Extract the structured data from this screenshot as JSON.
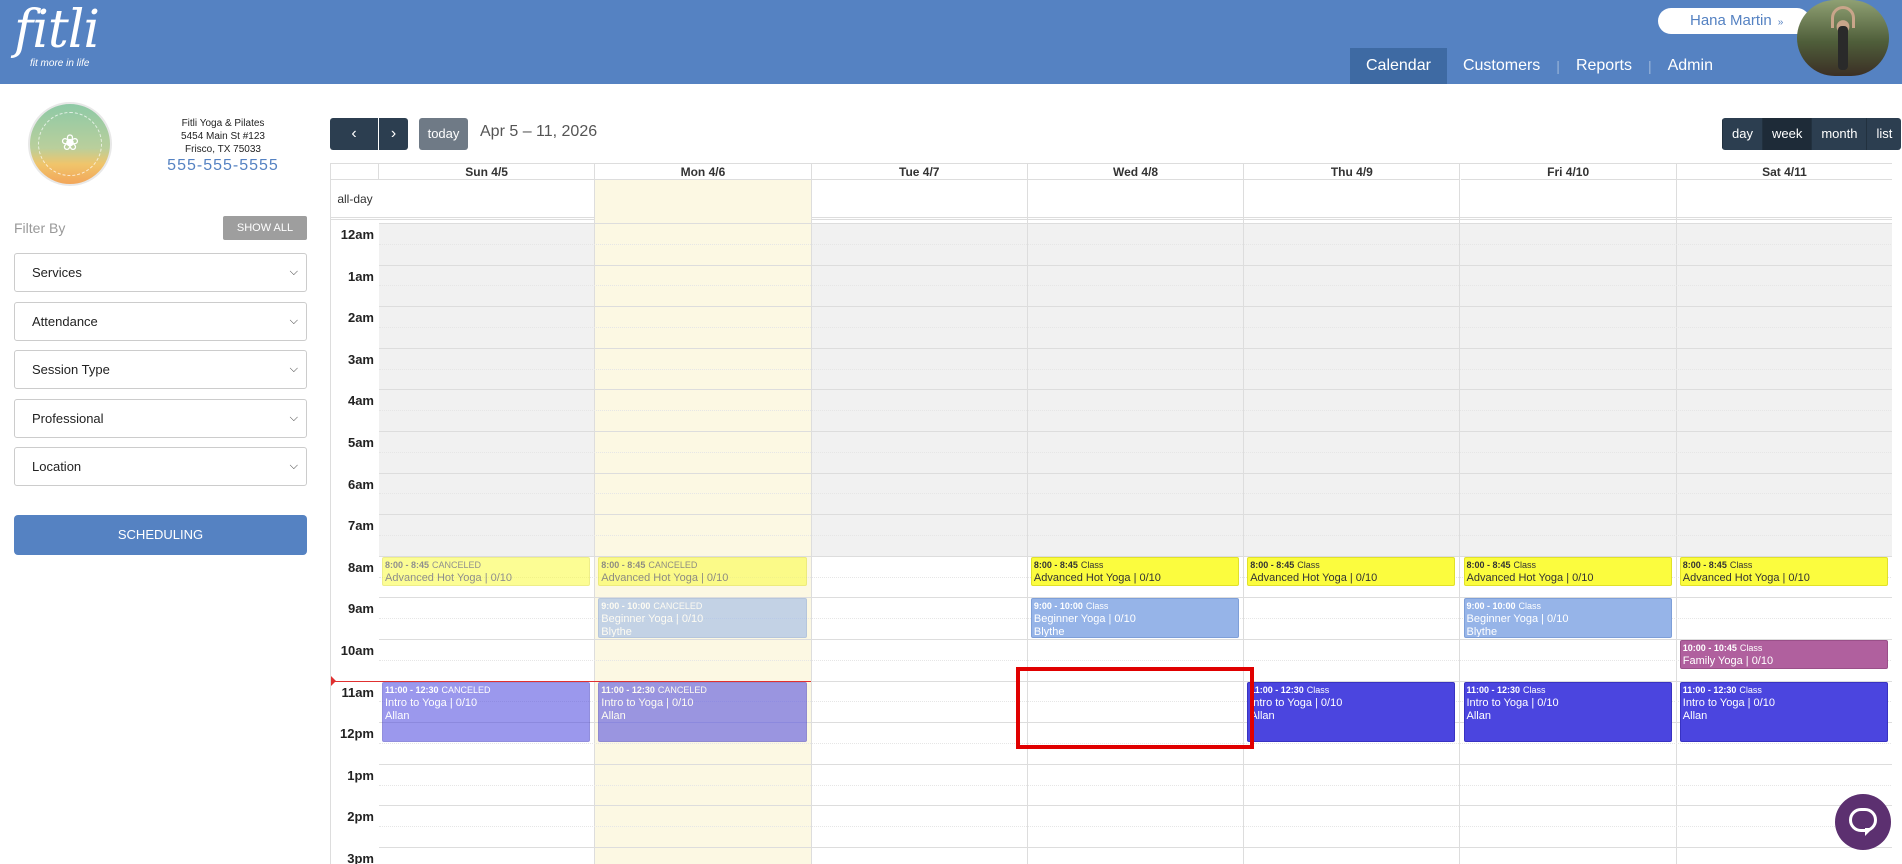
{
  "brand": {
    "logo_text": "fitli",
    "tagline": "fit more in life",
    "color": "#5582c2"
  },
  "user": {
    "name": "Hana Martin",
    "chevron": "»"
  },
  "nav": {
    "items": [
      "Calendar",
      "Customers",
      "Reports",
      "Admin"
    ],
    "active": "Calendar"
  },
  "studio": {
    "name": "Fitli Yoga & Pilates",
    "address1": "5454 Main St #123",
    "address2": "Frisco, TX 75033",
    "phone": "555-555-5555"
  },
  "filters": {
    "label": "Filter By",
    "show_all": "SHOW ALL",
    "selects": [
      "Services",
      "Attendance",
      "Session Type",
      "Professional",
      "Location"
    ],
    "scheduling": "SCHEDULING"
  },
  "toolbar": {
    "prev": "‹",
    "next": "›",
    "today": "today",
    "range": "Apr 5 – 11, 2026",
    "views": [
      "day",
      "week",
      "month",
      "list"
    ],
    "active_view": "week"
  },
  "calendar": {
    "all_day_label": "all-day",
    "days": [
      "Sun 4/5",
      "Mon 4/6",
      "Tue 4/7",
      "Wed 4/8",
      "Thu 4/9",
      "Fri 4/10",
      "Sat 4/11"
    ],
    "today_index": 1,
    "hours": [
      "12am",
      "1am",
      "2am",
      "3am",
      "4am",
      "5am",
      "6am",
      "7am",
      "8am",
      "9am",
      "10am",
      "11am",
      "12pm",
      "1pm",
      "2pm",
      "3pm"
    ],
    "events": [
      {
        "day": 0,
        "start": 8,
        "end": 8.75,
        "time": "8:00 - 8:45",
        "status": "CANCELED",
        "title": "Advanced Hot Yoga | 0/10",
        "who": "",
        "color": "yellow",
        "canceled": true
      },
      {
        "day": 1,
        "start": 8,
        "end": 8.75,
        "time": "8:00 - 8:45",
        "status": "CANCELED",
        "title": "Advanced Hot Yoga | 0/10",
        "who": "",
        "color": "yellow",
        "canceled": true
      },
      {
        "day": 3,
        "start": 8,
        "end": 8.75,
        "time": "8:00 - 8:45",
        "status": "Class",
        "title": "Advanced Hot Yoga | 0/10",
        "who": "",
        "color": "yellow",
        "canceled": false
      },
      {
        "day": 4,
        "start": 8,
        "end": 8.75,
        "time": "8:00 - 8:45",
        "status": "Class",
        "title": "Advanced Hot Yoga | 0/10",
        "who": "",
        "color": "yellow",
        "canceled": false
      },
      {
        "day": 5,
        "start": 8,
        "end": 8.75,
        "time": "8:00 - 8:45",
        "status": "Class",
        "title": "Advanced Hot Yoga | 0/10",
        "who": "",
        "color": "yellow",
        "canceled": false
      },
      {
        "day": 6,
        "start": 8,
        "end": 8.75,
        "time": "8:00 - 8:45",
        "status": "Class",
        "title": "Advanced Hot Yoga | 0/10",
        "who": "",
        "color": "yellow",
        "canceled": false
      },
      {
        "day": 1,
        "start": 9,
        "end": 10,
        "time": "9:00 - 10:00",
        "status": "CANCELED",
        "title": "Beginner Yoga | 0/10",
        "who": "Blythe",
        "color": "lightblue",
        "canceled": true
      },
      {
        "day": 3,
        "start": 9,
        "end": 10,
        "time": "9:00 - 10:00",
        "status": "Class",
        "title": "Beginner Yoga | 0/10",
        "who": "Blythe",
        "color": "lightblue",
        "canceled": false
      },
      {
        "day": 5,
        "start": 9,
        "end": 10,
        "time": "9:00 - 10:00",
        "status": "Class",
        "title": "Beginner Yoga | 0/10",
        "who": "Blythe",
        "color": "lightblue",
        "canceled": false
      },
      {
        "day": 6,
        "start": 10,
        "end": 10.75,
        "time": "10:00 - 10:45",
        "status": "Class",
        "title": "Family Yoga | 0/10",
        "who": "",
        "color": "magenta",
        "canceled": false
      },
      {
        "day": 0,
        "start": 11,
        "end": 12.5,
        "time": "11:00 - 12:30",
        "status": "CANCELED",
        "title": "Intro to Yoga | 0/10",
        "who": "Allan",
        "color": "purple",
        "canceled": true
      },
      {
        "day": 1,
        "start": 11,
        "end": 12.5,
        "time": "11:00 - 12:30",
        "status": "CANCELED",
        "title": "Intro to Yoga | 0/10",
        "who": "Allan",
        "color": "purple",
        "canceled": true
      },
      {
        "day": 4,
        "start": 11,
        "end": 12.5,
        "time": "11:00 - 12:30",
        "status": "Class",
        "title": "Intro to Yoga | 0/10",
        "who": "Allan",
        "color": "purple",
        "canceled": false
      },
      {
        "day": 5,
        "start": 11,
        "end": 12.5,
        "time": "11:00 - 12:30",
        "status": "Class",
        "title": "Intro to Yoga | 0/10",
        "who": "Allan",
        "color": "purple",
        "canceled": false
      },
      {
        "day": 6,
        "start": 11,
        "end": 12.5,
        "time": "11:00 - 12:30",
        "status": "Class",
        "title": "Intro to Yoga | 0/10",
        "who": "Allan",
        "color": "purple",
        "canceled": false
      }
    ]
  },
  "chat": {
    "icon": "chat-bubble-icon"
  }
}
